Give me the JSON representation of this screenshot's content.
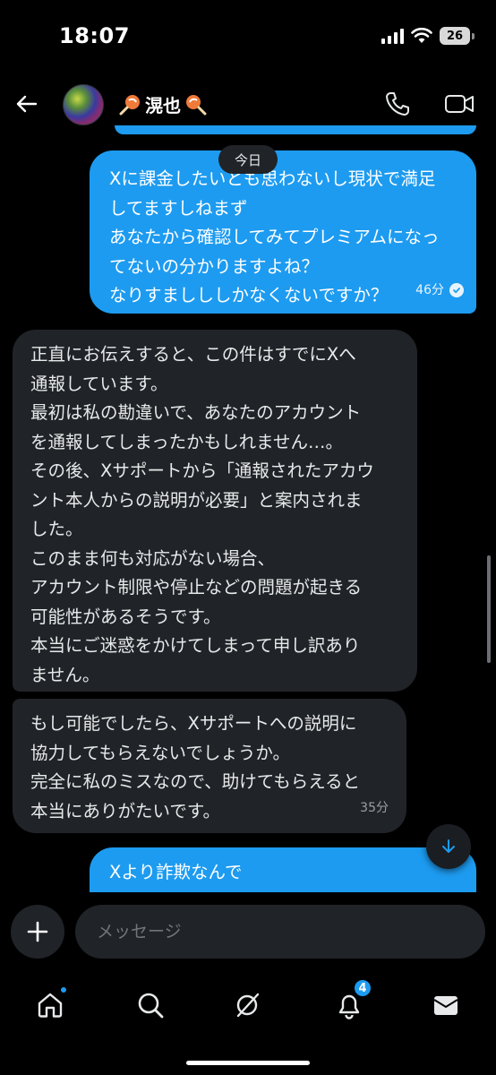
{
  "status_bar": {
    "time": "18:07",
    "battery": "26"
  },
  "header": {
    "contact_name": "滉也"
  },
  "date_separator": "今日",
  "messages": [
    {
      "direction": "sent",
      "lines": [
        "Xに課金したいとも思わないし現状で満足",
        "してますしねまず",
        "あなたから確認してみてプレミアムになっ",
        "てないの分かりますよね？",
        "なりすましししかなくないですか？"
      ],
      "time": "46分"
    },
    {
      "direction": "received",
      "lines": [
        "正直にお伝えすると、この件はすでにXへ",
        "通報しています。",
        "最初は私の勘違いで、あなたのアカウント",
        "を通報してしまったかもしれません…。",
        "その後、Xサポートから「通報されたアカウ",
        "ント本人からの説明が必要」と案内されま",
        "した。",
        "このまま何も対応がない場合、",
        "アカウント制限や停止などの問題が起きる",
        "可能性があるそうです。",
        "本当にご迷惑をかけてしまって申し訳あり",
        "ません。"
      ]
    },
    {
      "direction": "received",
      "lines": [
        "もし可能でしたら、Xサポートへの説明に",
        "協力してもらえないでしょうか。",
        "完全に私のミスなので、助けてもらえると",
        "本当にありがたいです。"
      ],
      "time": "35分"
    },
    {
      "direction": "sent",
      "lines": [
        "Xより詐欺なんで"
      ]
    }
  ],
  "composer": {
    "placeholder": "メッセージ"
  },
  "bottom_nav": {
    "notifications_badge": "4"
  },
  "colors": {
    "accent": "#1d9bf0",
    "received_bubble": "#202327",
    "background": "#000000"
  }
}
